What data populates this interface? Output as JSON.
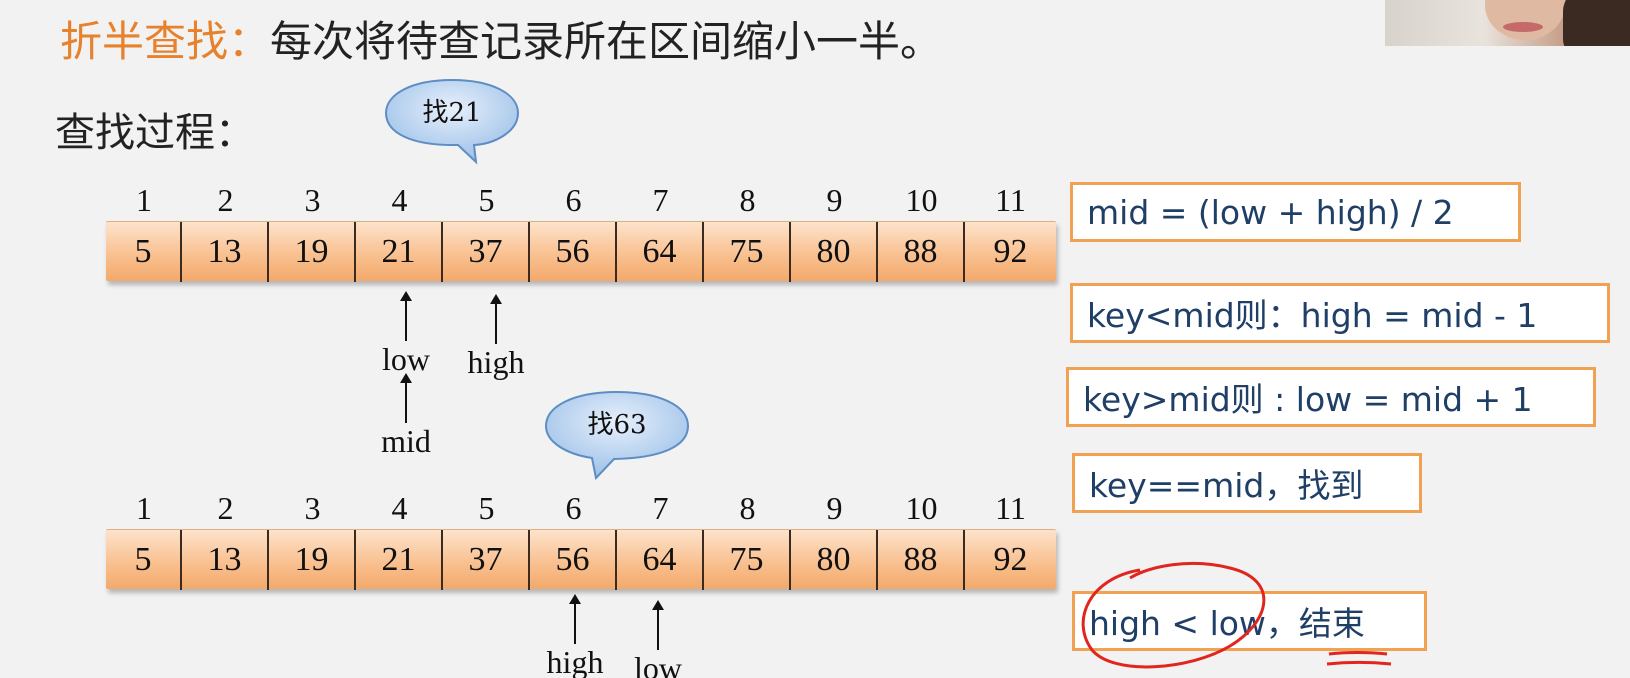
{
  "title": {
    "accent": "折半查找：",
    "text": "每次将待查记录所在区间缩小一半。"
  },
  "process_label": "查找过程：",
  "bubbles": [
    {
      "text": "找21"
    },
    {
      "text": "找63"
    }
  ],
  "indices": [
    "1",
    "2",
    "3",
    "4",
    "5",
    "6",
    "7",
    "8",
    "9",
    "10",
    "11"
  ],
  "values": [
    "5",
    "13",
    "19",
    "21",
    "37",
    "56",
    "64",
    "75",
    "80",
    "88",
    "92"
  ],
  "pointers_top": {
    "low": "low",
    "high": "high",
    "mid": "mid"
  },
  "pointers_bottom": {
    "high": "high",
    "low": "low"
  },
  "rules": [
    "mid = (low + high) / 2",
    "key<mid则：high = mid - 1",
    "key>mid则 : low = mid + 1",
    "key==mid，找到",
    "high < low，结束"
  ],
  "colors": {
    "accent": "#e8812c",
    "rule_border": "#f0a152",
    "rule_text": "#1f3f66",
    "annotation": "#e0261f"
  }
}
